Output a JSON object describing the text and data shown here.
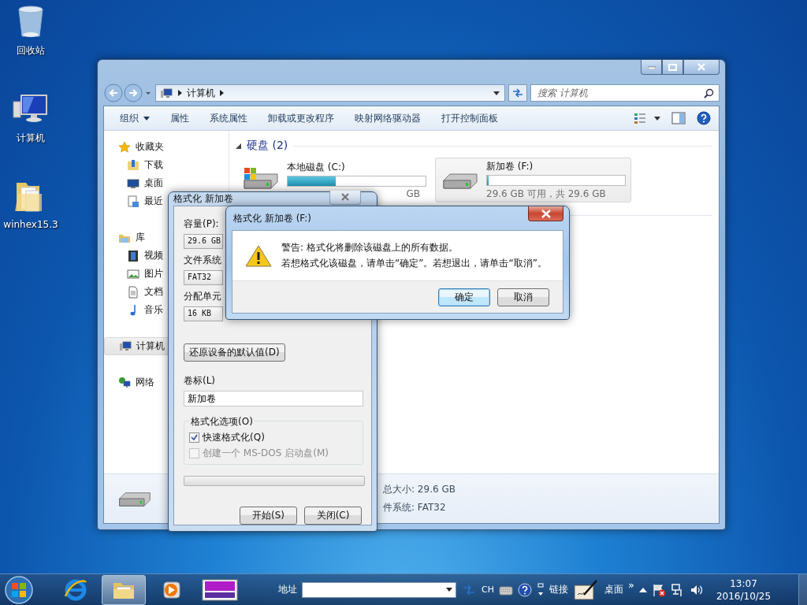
{
  "desktop_icons": [
    {
      "label": "回收站",
      "kind": "recycle"
    },
    {
      "label": "计算机",
      "kind": "computer"
    },
    {
      "label": "winhex15.3",
      "kind": "folder"
    }
  ],
  "explorer": {
    "breadcrumb": [
      "计算机"
    ],
    "search": {
      "placeholder": "搜索 计算机"
    },
    "toolbar": [
      {
        "label": "组织",
        "kind": "menu"
      },
      {
        "label": "属性",
        "kind": "button"
      },
      {
        "label": "系统属性",
        "kind": "button"
      },
      {
        "label": "卸载或更改程序",
        "kind": "button"
      },
      {
        "label": "映射网络驱动器",
        "kind": "button"
      },
      {
        "label": "打开控制面板",
        "kind": "button"
      }
    ],
    "nav": [
      {
        "label": "收藏夹",
        "kind": "star",
        "selected": false,
        "children": [
          {
            "label": "下载",
            "kind": "download",
            "selected": false
          },
          {
            "label": "桌面",
            "kind": "desktop",
            "selected": false
          },
          {
            "label": "最近",
            "kind": "recent",
            "selected": false
          }
        ]
      },
      {
        "label": "库",
        "kind": "library",
        "selected": false,
        "children": [
          {
            "label": "视频",
            "kind": "video",
            "selected": false
          },
          {
            "label": "图片",
            "kind": "picture",
            "selected": false
          },
          {
            "label": "文档",
            "kind": "document",
            "selected": false
          },
          {
            "label": "音乐",
            "kind": "music",
            "selected": false
          }
        ]
      },
      {
        "label": "计算机",
        "kind": "computer",
        "selected": true
      },
      {
        "label": "网络",
        "kind": "network",
        "selected": false
      }
    ],
    "group": {
      "title": "硬盘 (2)",
      "expanded": true
    },
    "drives": [
      {
        "name": "本地磁盘 (C:)",
        "kind": "system",
        "level": 0.35,
        "free": "GB",
        "selected": false
      },
      {
        "name": "新加卷 (F:)",
        "kind": "plain",
        "level": 0.01,
        "free": "29.6 GB 可用，共 29.6 GB",
        "selected": true
      }
    ],
    "details": [
      "总大小: 29.6 GB",
      "件系统: FAT32"
    ]
  },
  "format_dialog": {
    "title": "格式化 新加卷",
    "fields": [
      {
        "label": "容量(P):",
        "value": "29.6 GB"
      },
      {
        "label": "文件系统",
        "value": "FAT32"
      },
      {
        "label": "分配单元",
        "value": "16 KB"
      }
    ],
    "restore_button": "还原设备的默认值(D)",
    "volume_label": {
      "label": "卷标(L)",
      "value": "新加卷"
    },
    "options": {
      "title": "格式化选项(O)",
      "items": [
        {
          "label": "快速格式化(Q)",
          "checked": true,
          "disabled": false
        },
        {
          "label": "创建一个 MS-DOS 启动盘(M)",
          "checked": false,
          "disabled": true
        }
      ]
    },
    "buttons": [
      "开始(S)",
      "关闭(C)"
    ]
  },
  "message_box": {
    "title": "格式化 新加卷 (F:)",
    "lines": [
      "警告: 格式化将删除该磁盘上的所有数据。",
      "若想格式化该磁盘，请单击“确定”。若想退出，请单击“取消”。"
    ],
    "buttons": [
      {
        "label": "确定",
        "default": true
      },
      {
        "label": "取消",
        "default": false
      }
    ]
  },
  "taskbar": {
    "apps": [
      {
        "kind": "ie",
        "active": false
      },
      {
        "kind": "explorer",
        "active": true
      },
      {
        "kind": "media",
        "active": false
      },
      {
        "kind": "hex",
        "active": false
      }
    ],
    "address_label": "地址",
    "language": "CH",
    "links_label": "链接",
    "desktop_label": "桌面",
    "chevron": "»",
    "time": "13:07",
    "date": "2016/10/25"
  }
}
